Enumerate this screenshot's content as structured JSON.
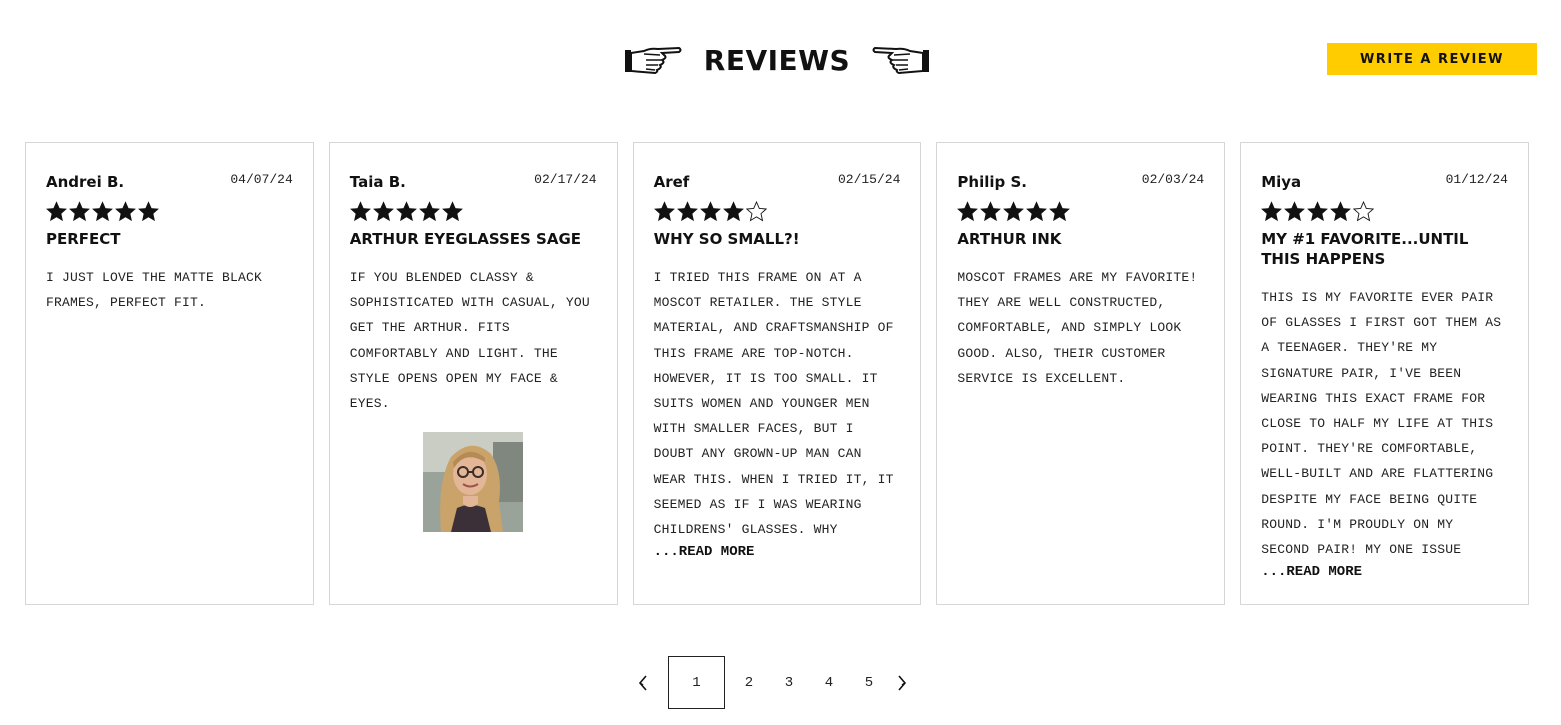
{
  "header": {
    "title": "REVIEWS",
    "write_review_label": "WRITE A REVIEW",
    "left_icon": "pointing-hand-right-icon",
    "right_icon": "pointing-hand-left-icon"
  },
  "reviews": [
    {
      "author": "Andrei B.",
      "date": "04/07/24",
      "rating": 5,
      "title": "PERFECT",
      "body": "I just love the matte black frames, perfect fit.",
      "read_more": "",
      "has_photo": false
    },
    {
      "author": "Taia B.",
      "date": "02/17/24",
      "rating": 5,
      "title": "ARTHUR EYEGLASSES SAGE",
      "body": "If you blended classy & sophisticated with casual, you get the Arthur. Fits comfortably and light. The style opens open my face & eyes.",
      "read_more": "",
      "has_photo": true
    },
    {
      "author": "Aref",
      "date": "02/15/24",
      "rating": 4,
      "title": "WHY SO SMALL?!",
      "body": "I tried this frame on at a Moscot retailer. The style material, and craftsmanship of this frame are top-notch. However, it is too small. It suits women and younger men with smaller faces, but I doubt any grown-up man can wear this. When I tried it, it seemed as if I was wearing childrens' glasses. Why",
      "read_more": "...READ MORE",
      "has_photo": false
    },
    {
      "author": "Philip S.",
      "date": "02/03/24",
      "rating": 5,
      "title": "ARTHUR INK",
      "body": "Moscot frames are my favorite! They are well constructed, comfortable, and simply look good. Also, their customer service is excellent.",
      "read_more": "",
      "has_photo": false
    },
    {
      "author": "Miya",
      "date": "01/12/24",
      "rating": 4,
      "title": "MY #1 FAVORITE...UNTIL THIS HAPPENS",
      "body": "This is my favorite ever pair of glasses I first got them as a teenager. They're my signature pair, I've been wearing this exact frame for close to half my life at this point. They're comfortable, well-built and are flattering despite my face being quite round. I'm proudly on my second pair! My one issue",
      "read_more": "...READ MORE",
      "has_photo": false
    }
  ],
  "rating_max": 5,
  "pagination": {
    "prev_icon": "chevron-left-icon",
    "next_icon": "chevron-right-icon",
    "pages": [
      "1",
      "2",
      "3",
      "4",
      "5"
    ],
    "current": "1"
  },
  "colors": {
    "accent": "#ffcc00",
    "text": "#111111",
    "border": "#d6d6d6"
  }
}
